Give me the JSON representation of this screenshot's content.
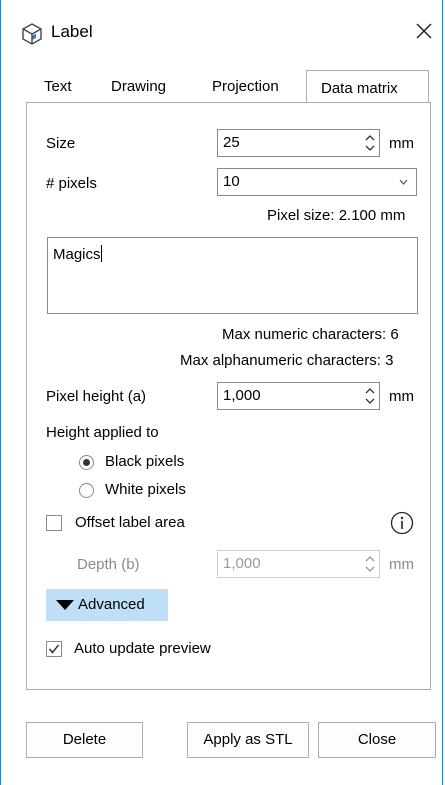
{
  "window": {
    "title": "Label",
    "icon": "cube-icon",
    "close_icon": "close-icon"
  },
  "tabs": [
    {
      "label": "Text",
      "active": false
    },
    {
      "label": "Drawing",
      "active": false
    },
    {
      "label": "Projection",
      "active": false
    },
    {
      "label": "Data matrix",
      "active": true
    }
  ],
  "data_matrix": {
    "size": {
      "label": "Size",
      "value": "25",
      "unit": "mm"
    },
    "pixels": {
      "label": "# pixels",
      "value": "10"
    },
    "pixel_size": "Pixel size: 2.100  mm",
    "text_value": "Magics",
    "max_numeric": "Max numeric characters: 6",
    "max_alphanumeric": "Max alphanumeric characters: 3",
    "pixel_height": {
      "label": "Pixel height (a)",
      "value": "1,000",
      "unit": "mm"
    },
    "height_applied_to": {
      "label": "Height applied to",
      "options": [
        {
          "label": "Black pixels",
          "selected": true
        },
        {
          "label": "White pixels",
          "selected": false
        }
      ]
    },
    "offset_label_area": {
      "label": "Offset label area",
      "checked": false,
      "info_icon": "info-icon"
    },
    "depth": {
      "label": "Depth (b)",
      "value": "1,000",
      "unit": "mm",
      "enabled": false
    },
    "advanced": {
      "label": "Advanced",
      "icon": "triangle-down-icon"
    },
    "auto_update": {
      "label": "Auto update preview",
      "checked": true
    }
  },
  "buttons": {
    "delete": "Delete",
    "apply": "Apply as STL",
    "close": "Close"
  },
  "colors": {
    "accent_border": "#1e88d3",
    "advanced_bg": "#bfdff7"
  }
}
